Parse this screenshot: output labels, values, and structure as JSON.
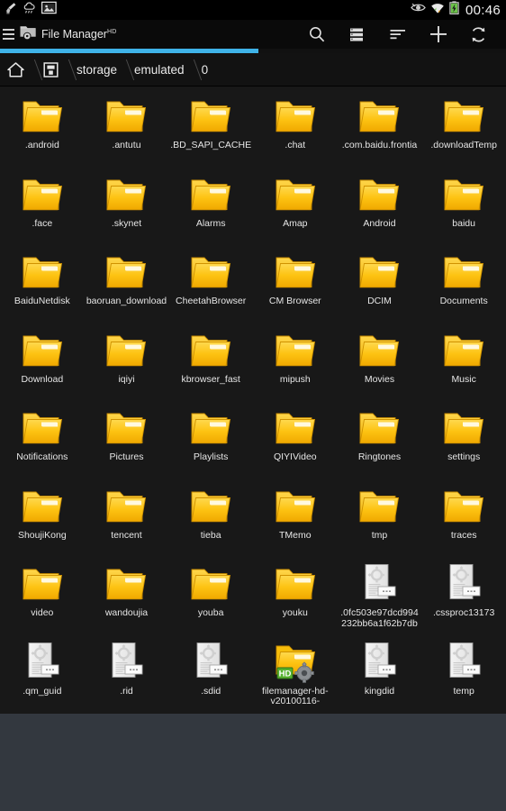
{
  "statusbar": {
    "time": "00:46",
    "left_icons": [
      "brush-icon",
      "cloud-icon",
      "image-icon"
    ],
    "right_icons": [
      "eye-icon",
      "wifi-icon",
      "battery-charging-icon"
    ]
  },
  "actionbar": {
    "menu_icon": "hamburger-menu-icon",
    "app_icon": "folder-settings-icon",
    "title": "File Manager",
    "title_sup": "HD",
    "actions": [
      {
        "name": "search-button",
        "icon": "search-icon"
      },
      {
        "name": "view-mode-button",
        "icon": "list-view-icon"
      },
      {
        "name": "sort-button",
        "icon": "sort-icon"
      },
      {
        "name": "add-button",
        "icon": "plus-icon"
      },
      {
        "name": "refresh-button",
        "icon": "refresh-icon"
      }
    ]
  },
  "progress": {
    "percent": 51,
    "color": "#3fb3e8"
  },
  "breadcrumb": {
    "items": [
      {
        "label": "",
        "icon": "home-icon",
        "name": "breadcrumb-home"
      },
      {
        "label": "",
        "icon": "device-storage-icon",
        "name": "breadcrumb-device"
      },
      {
        "label": "storage",
        "icon": "",
        "name": "breadcrumb-storage"
      },
      {
        "label": "emulated",
        "icon": "",
        "name": "breadcrumb-emulated"
      },
      {
        "label": "0",
        "icon": "",
        "name": "breadcrumb-0"
      }
    ]
  },
  "grid": {
    "background": "#181818",
    "items": [
      {
        "label": ".android",
        "type": "folder"
      },
      {
        "label": ".antutu",
        "type": "folder"
      },
      {
        "label": ".BD_SAPI_CACHE",
        "type": "folder"
      },
      {
        "label": ".chat",
        "type": "folder"
      },
      {
        "label": ".com.baidu.frontia",
        "type": "folder"
      },
      {
        "label": ".downloadTemp",
        "type": "folder"
      },
      {
        "label": ".face",
        "type": "folder"
      },
      {
        "label": ".skynet",
        "type": "folder"
      },
      {
        "label": "Alarms",
        "type": "folder"
      },
      {
        "label": "Amap",
        "type": "folder"
      },
      {
        "label": "Android",
        "type": "folder"
      },
      {
        "label": "baidu",
        "type": "folder"
      },
      {
        "label": "BaiduNetdisk",
        "type": "folder"
      },
      {
        "label": "baoruan_download",
        "type": "folder"
      },
      {
        "label": "CheetahBrowser",
        "type": "folder"
      },
      {
        "label": "CM Browser",
        "type": "folder"
      },
      {
        "label": "DCIM",
        "type": "folder"
      },
      {
        "label": "Documents",
        "type": "folder"
      },
      {
        "label": "Download",
        "type": "folder"
      },
      {
        "label": "iqiyi",
        "type": "folder"
      },
      {
        "label": "kbrowser_fast",
        "type": "folder"
      },
      {
        "label": "mipush",
        "type": "folder"
      },
      {
        "label": "Movies",
        "type": "folder"
      },
      {
        "label": "Music",
        "type": "folder"
      },
      {
        "label": "Notifications",
        "type": "folder"
      },
      {
        "label": "Pictures",
        "type": "folder"
      },
      {
        "label": "Playlists",
        "type": "folder"
      },
      {
        "label": "QIYIVideo",
        "type": "folder"
      },
      {
        "label": "Ringtones",
        "type": "folder"
      },
      {
        "label": "settings",
        "type": "folder"
      },
      {
        "label": "ShoujiKong",
        "type": "folder"
      },
      {
        "label": "tencent",
        "type": "folder"
      },
      {
        "label": "tieba",
        "type": "folder"
      },
      {
        "label": "TMemo",
        "type": "folder"
      },
      {
        "label": "tmp",
        "type": "folder"
      },
      {
        "label": "traces",
        "type": "folder"
      },
      {
        "label": "video",
        "type": "folder"
      },
      {
        "label": "wandoujia",
        "type": "folder"
      },
      {
        "label": "youba",
        "type": "folder"
      },
      {
        "label": "youku",
        "type": "folder"
      },
      {
        "label": ".0fc503e97dcd994232bb6a1f62b7db",
        "type": "file"
      },
      {
        "label": ".cssproc13173",
        "type": "file"
      },
      {
        "label": ".qm_guid",
        "type": "file"
      },
      {
        "label": ".rid",
        "type": "file"
      },
      {
        "label": ".sdid",
        "type": "file"
      },
      {
        "label": "filemanager-hd-v20100116-",
        "type": "folder-hd"
      },
      {
        "label": "kingdid",
        "type": "file"
      },
      {
        "label": "temp",
        "type": "file"
      }
    ]
  },
  "colors": {
    "folder_light": "#ffd84d",
    "folder_mid": "#fcc21b",
    "folder_dark": "#e9a400",
    "file_page": "#f0f0f0",
    "accent": "#3fb3e8",
    "hd_badge": "#57b22e",
    "empty_area": "#33383f"
  }
}
